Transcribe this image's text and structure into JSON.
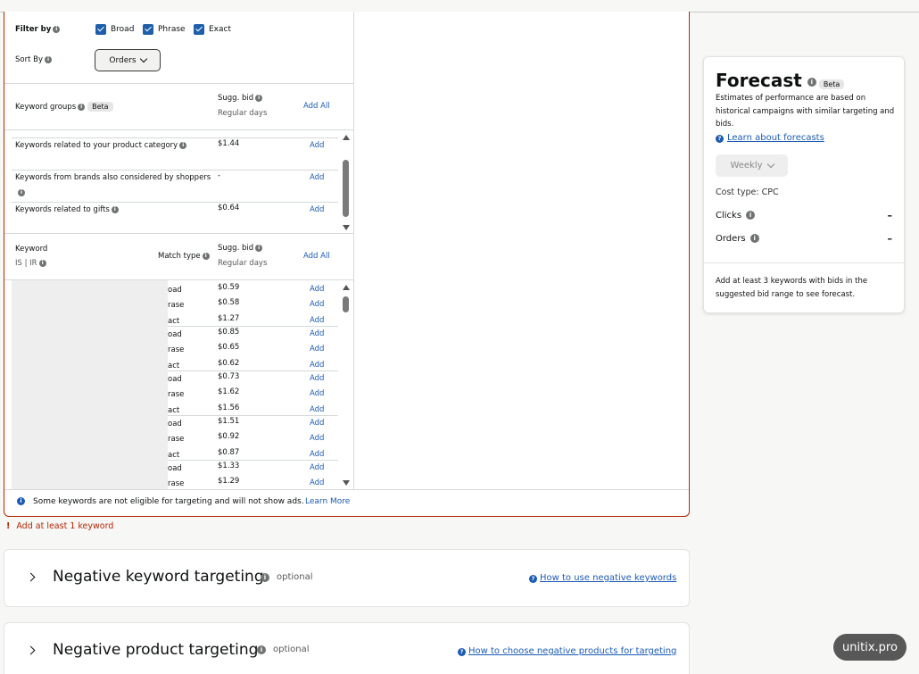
{
  "filter": {
    "filter_by_label": "Filter by",
    "options": [
      "Broad",
      "Phrase",
      "Exact"
    ],
    "sort_by_label": "Sort By",
    "sort_value": "Orders"
  },
  "groups_table": {
    "header_label": "Keyword groups",
    "beta": "Beta",
    "sugg_bid": "Sugg. bid",
    "regular_days": "Regular days",
    "add_all": "Add All",
    "rows": [
      {
        "label": "Keywords related to your product category",
        "bid": "$1.44",
        "add": "Add"
      },
      {
        "label": "Keywords from brands also considered by shoppers",
        "bid": "-",
        "add": "Add"
      },
      {
        "label": "Keywords related to gifts",
        "bid": "$0.64",
        "add": "Add"
      }
    ]
  },
  "keyword_table": {
    "keyword_label": "Keyword",
    "is_ir": "IS | IR",
    "match_type": "Match type",
    "sugg_bid": "Sugg. bid",
    "regular_days": "Regular days",
    "add_all": "Add All",
    "rows": [
      {
        "mt": "oad",
        "bid": "$0.59",
        "add": "Add"
      },
      {
        "mt": "rase",
        "bid": "$0.58",
        "add": "Add"
      },
      {
        "mt": "act",
        "bid": "$1.27",
        "add": "Add"
      },
      {
        "mt": "oad",
        "bid": "$0.85",
        "add": "Add"
      },
      {
        "mt": "rase",
        "bid": "$0.65",
        "add": "Add"
      },
      {
        "mt": "act",
        "bid": "$0.62",
        "add": "Add"
      },
      {
        "mt": "oad",
        "bid": "$0.73",
        "add": "Add"
      },
      {
        "mt": "rase",
        "bid": "$1.62",
        "add": "Add"
      },
      {
        "mt": "act",
        "bid": "$1.56",
        "add": "Add"
      },
      {
        "mt": "oad",
        "bid": "$1.51",
        "add": "Add"
      },
      {
        "mt": "rase",
        "bid": "$0.92",
        "add": "Add"
      },
      {
        "mt": "act",
        "bid": "$0.87",
        "add": "Add"
      },
      {
        "mt": "oad",
        "bid": "$1.33",
        "add": "Add"
      },
      {
        "mt": "rase",
        "bid": "$1.29",
        "add": "Add"
      }
    ]
  },
  "notice": {
    "text": "Some keywords are not eligible for targeting and will not show ads.",
    "link": "Learn More"
  },
  "error": "Add at least 1 keyword",
  "negative_keyword": {
    "title": "Negative keyword targeting",
    "optional": "optional",
    "help": "How to use negative keywords"
  },
  "negative_product": {
    "title": "Negative product targeting",
    "optional": "optional",
    "help": "How to choose negative products for targeting"
  },
  "forecast": {
    "title": "Forecast",
    "beta": "Beta",
    "description": "Estimates of performance are based on historical campaigns with similar targeting and bids.",
    "learn": "Learn about forecasts",
    "period": "Weekly",
    "cost_type": "Cost type: CPC",
    "clicks_label": "Clicks",
    "clicks_value": "–",
    "orders_label": "Orders",
    "orders_value": "–",
    "footnote": "Add at least 3 keywords with bids in the suggested bid range to see forecast."
  },
  "watermark": "unitix.pro",
  "colors": {
    "accent": "#1b5bb3",
    "error": "#b12704",
    "checkbox": "#1e5eaa"
  }
}
